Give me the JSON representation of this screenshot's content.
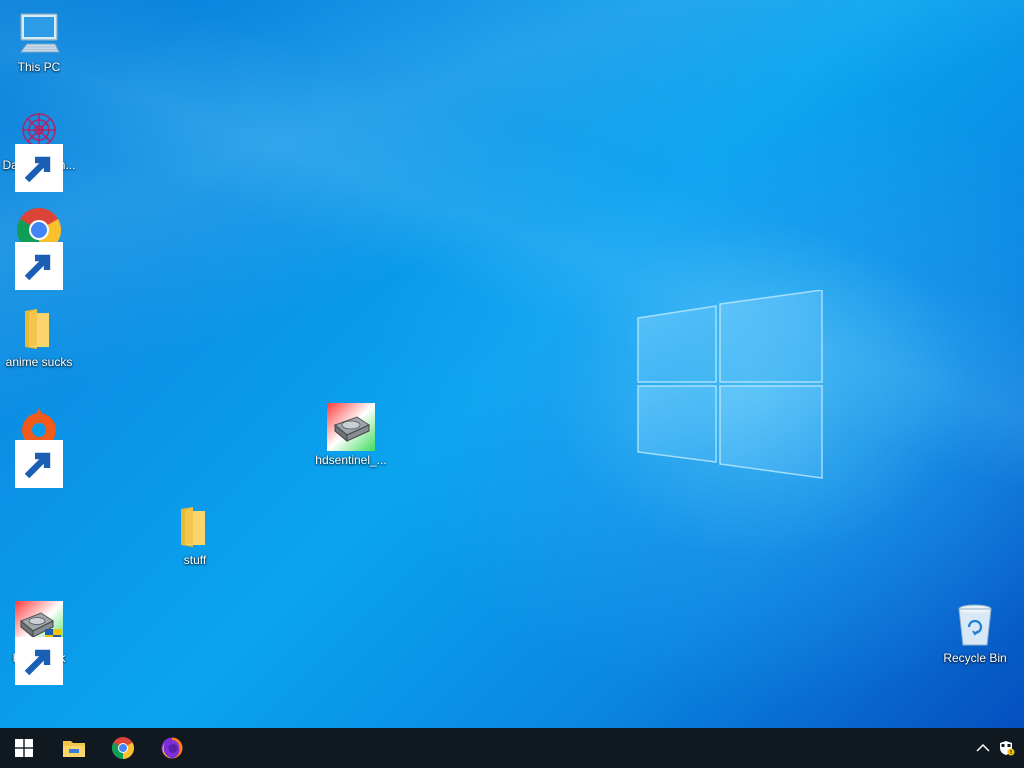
{
  "desktop": {
    "icons": [
      {
        "label": "This PC",
        "icon": "computer-icon",
        "shortcut": false
      },
      {
        "label": "DataWagon...",
        "icon": "datawagon-icon",
        "shortcut": true
      },
      {
        "label": "Google Chrome",
        "icon": "chrome-icon",
        "shortcut": true
      },
      {
        "label": "anime sucks",
        "icon": "folder-icon",
        "shortcut": false
      },
      {
        "label": "Origin",
        "icon": "origin-icon",
        "shortcut": true
      },
      {
        "label": "hdsentinel_...",
        "icon": "hdsentinel-icon",
        "shortcut": false
      },
      {
        "label": "stuff",
        "icon": "folder-icon",
        "shortcut": false
      },
      {
        "label": "Hard Disk Sentinel",
        "icon": "hard-disk-sentinel-icon",
        "shortcut": true
      },
      {
        "label": "Recycle Bin",
        "icon": "recycle-bin-icon",
        "shortcut": false
      }
    ]
  },
  "taskbar": {
    "start_icon": "windows-start-icon",
    "pinned": [
      {
        "name": "File Explorer",
        "icon": "file-explorer-icon"
      },
      {
        "name": "Google Chrome",
        "icon": "chrome-icon"
      },
      {
        "name": "Firefox",
        "icon": "firefox-icon"
      }
    ],
    "tray": [
      {
        "icon": "chevron-up-icon"
      },
      {
        "icon": "security-alert-icon"
      }
    ]
  },
  "colors": {
    "desktop_accent": "#0a8fe4",
    "taskbar": "#101820"
  }
}
